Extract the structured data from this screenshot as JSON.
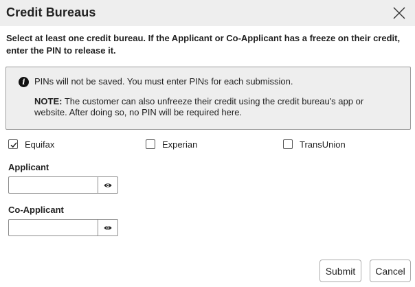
{
  "dialog": {
    "title": "Credit Bureaus",
    "instructions": "Select at least one credit bureau. If the Applicant or Co-Applicant has a freeze on their credit, enter the PIN to release it."
  },
  "info": {
    "icon": "info-circle-icon",
    "line1": "PINs will not be saved. You must enter PINs for each submission.",
    "note_label": "NOTE:",
    "note_text": " The customer can also unfreeze their credit using the credit bureau's app or website. After doing so, no PIN will be required here."
  },
  "bureaus": [
    {
      "label": "Equifax",
      "checked": true
    },
    {
      "label": "Experian",
      "checked": false
    },
    {
      "label": "TransUnion",
      "checked": false
    }
  ],
  "fields": {
    "applicant": {
      "label": "Applicant",
      "value": "",
      "placeholder": ""
    },
    "co_applicant": {
      "label": "Co-Applicant",
      "value": "",
      "placeholder": ""
    }
  },
  "buttons": {
    "submit": "Submit",
    "cancel": "Cancel"
  },
  "icons": {
    "close": "close-icon",
    "eye": "eye-icon",
    "check": "checkmark-icon"
  }
}
